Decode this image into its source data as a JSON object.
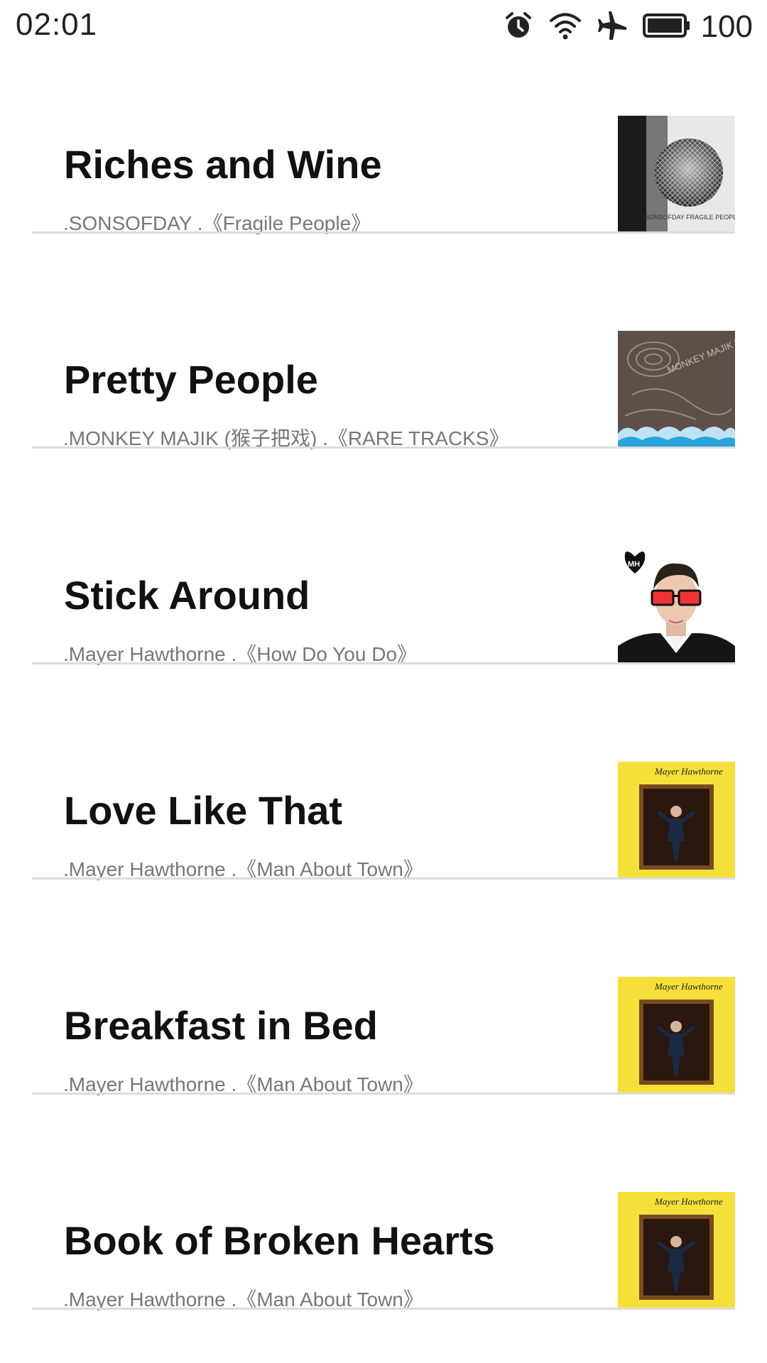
{
  "status_bar": {
    "time": "02:01",
    "battery": "100",
    "icons": [
      "alarm-icon",
      "wifi-icon",
      "airplane-mode-icon",
      "battery-icon"
    ]
  },
  "songs": [
    {
      "title": "Riches and Wine",
      "artist": ".SONSOFDAY",
      "album": "Fragile People",
      "cover_text": "SONSOFDAY FRAGILE PEOPLE"
    },
    {
      "title": "Pretty People",
      "artist": ".MONKEY MAJIK (猴子把戏)",
      "album": "RARE TRACKS",
      "cover_text": "MONKEY MAJIK RARE TRACKS"
    },
    {
      "title": "Stick Around",
      "artist": ".Mayer Hawthorne",
      "album": "How Do You Do",
      "cover_text": "MH"
    },
    {
      "title": "Love Like That",
      "artist": ".Mayer Hawthorne",
      "album": "Man About Town",
      "cover_text": "Mayer Hawthorne"
    },
    {
      "title": "Breakfast in Bed",
      "artist": ".Mayer Hawthorne",
      "album": "Man About Town",
      "cover_text": "Mayer Hawthorne"
    },
    {
      "title": "Book of Broken Hearts",
      "artist": ".Mayer Hawthorne",
      "album": "Man About Town",
      "cover_text": "Mayer Hawthorne"
    }
  ],
  "subtitle_format": {
    "separator": " .",
    "album_open": "《",
    "album_close": "》"
  },
  "colors": {
    "title": "#111111",
    "subtitle": "#777777",
    "divider": "#dcdcdc",
    "yellow_cover": "#f5e03a"
  }
}
